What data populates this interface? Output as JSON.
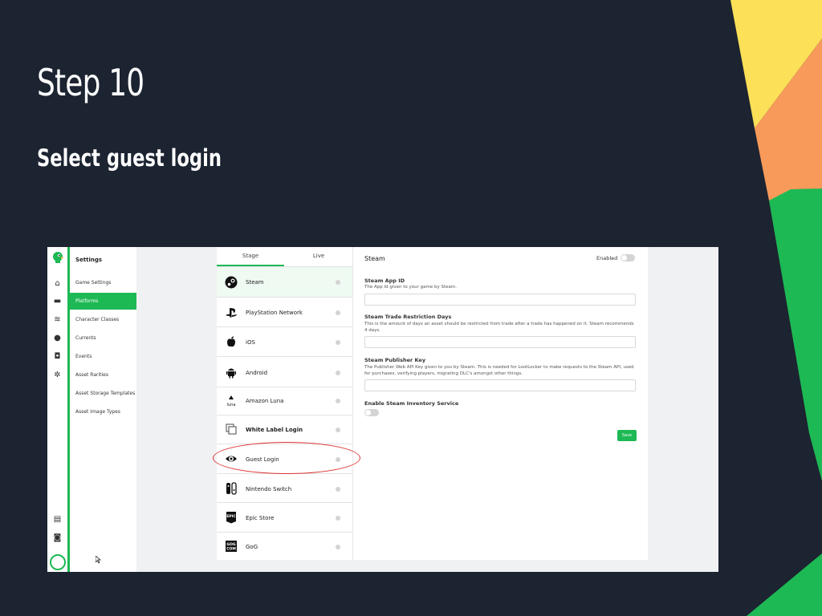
{
  "slide": {
    "title": "Step 10",
    "subtitle": "Select guest login"
  },
  "colors": {
    "background": "#1c2331",
    "accent": "#1db954",
    "deco_yellow": "#fbe058",
    "deco_orange": "#f89a5a",
    "deco_green": "#1db954"
  },
  "rail_icons": [
    "home-icon",
    "gamepad-icon",
    "layers-icon",
    "user-icon",
    "events-icon",
    "gear-icon",
    "document-icon",
    "discord-icon"
  ],
  "nav": {
    "title": "Settings",
    "items": [
      {
        "label": "Game Settings",
        "active": false
      },
      {
        "label": "Platforms",
        "active": true
      },
      {
        "label": "Character Classes",
        "active": false
      },
      {
        "label": "Currents",
        "active": false
      },
      {
        "label": "Events",
        "active": false
      },
      {
        "label": "Asset Rarities",
        "active": false
      },
      {
        "label": "Asset Storage Templates",
        "active": false
      },
      {
        "label": "Asset Image Types",
        "active": false
      }
    ]
  },
  "tabs": {
    "stage": "Stage",
    "live": "Live"
  },
  "platforms": [
    {
      "label": "Steam",
      "icon": "steam-icon",
      "selected": true,
      "bold": false
    },
    {
      "label": "PlayStation Network",
      "icon": "playstation-icon",
      "selected": false,
      "bold": false
    },
    {
      "label": "iOS",
      "icon": "apple-icon",
      "selected": false,
      "bold": false
    },
    {
      "label": "Android",
      "icon": "android-icon",
      "selected": false,
      "bold": false
    },
    {
      "label": "Amazon Luna",
      "icon": "luna-icon",
      "selected": false,
      "bold": false
    },
    {
      "label": "White Label Login",
      "icon": "white-label-icon",
      "selected": false,
      "bold": true
    },
    {
      "label": "Guest Login",
      "icon": "eye-icon",
      "selected": false,
      "bold": false
    },
    {
      "label": "Nintendo Switch",
      "icon": "switch-icon",
      "selected": false,
      "bold": false
    },
    {
      "label": "Epic Store",
      "icon": "epic-icon",
      "selected": false,
      "bold": false
    },
    {
      "label": "GoG",
      "icon": "gog-icon",
      "selected": false,
      "bold": false
    }
  ],
  "detail": {
    "title": "Steam",
    "enabled_label": "Enabled",
    "fields": [
      {
        "label": "Steam App ID",
        "help": "The App Id given to your game by Steam."
      },
      {
        "label": "Steam Trade Restriction Days",
        "help": "This is the amount of days an asset should be restricted from trade after a trade has happened on it. Steam recommends 4 days."
      },
      {
        "label": "Steam Publisher Key",
        "help": "The Publisher Web API Key given to you by Steam. This is needed for LootLocker to make requests to the Steam API, used for purchases, verifying players, migrating DLC's amongst other things."
      }
    ],
    "inventory_label": "Enable Steam Inventory Service",
    "save_label": "Save"
  },
  "logo_label": "LootLocker parrot logo"
}
